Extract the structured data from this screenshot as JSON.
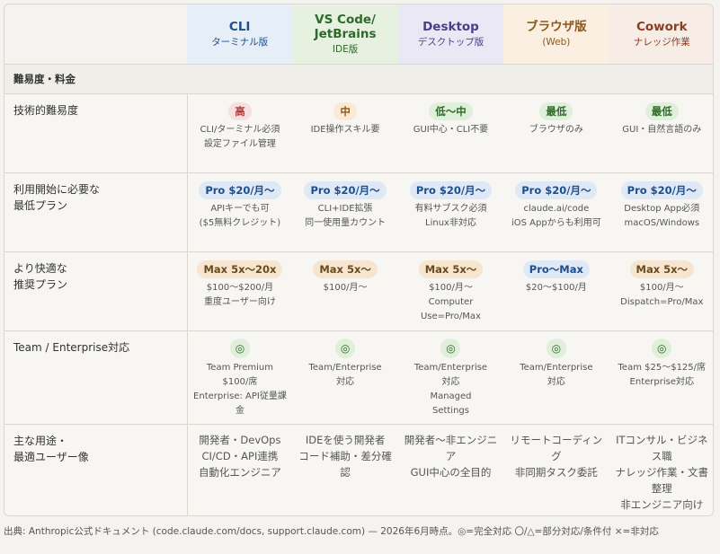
{
  "columns": [
    {
      "name": "CLI",
      "sub": "ターミナル版"
    },
    {
      "name": "VS Code/\nJetBrains",
      "sub": "IDE版"
    },
    {
      "name": "Desktop",
      "sub": "デスクトップ版"
    },
    {
      "name": "ブラウザ版",
      "sub": "(Web)"
    },
    {
      "name": "Cowork",
      "sub": "ナレッジ作業"
    }
  ],
  "section": "難易度・料金",
  "rows": [
    {
      "label": "技術的難易度",
      "cells": [
        {
          "pill": "高",
          "note": "CLI/ターミナル必須\n設定ファイル管理"
        },
        {
          "pill": "中",
          "note": "IDE操作スキル要"
        },
        {
          "pill": "低〜中",
          "note": "GUI中心・CLI不要"
        },
        {
          "pill": "最低",
          "note": "ブラウザのみ"
        },
        {
          "pill": "最低",
          "note": "GUI・自然言語のみ"
        }
      ]
    },
    {
      "label": "利用開始に必要な\n最低プラン",
      "cells": [
        {
          "pill": "Pro $20/月〜",
          "note": "APIキーでも可\n($5無料クレジット)"
        },
        {
          "pill": "Pro $20/月〜",
          "note": "CLI+IDE拡張\n同一使用量カウント"
        },
        {
          "pill": "Pro $20/月〜",
          "note": "有料サブスク必須\nLinux非対応"
        },
        {
          "pill": "Pro $20/月〜",
          "note": "claude.ai/code\niOS Appからも利用可"
        },
        {
          "pill": "Pro $20/月〜",
          "note": "Desktop App必須\nmacOS/Windows"
        }
      ]
    },
    {
      "label": "より快適な\n推奨プラン",
      "cells": [
        {
          "pill": "Max 5x〜20x",
          "note": "$100〜$200/月\n重度ユーザー向け"
        },
        {
          "pill": "Max 5x〜",
          "note": "$100/月〜"
        },
        {
          "pill": "Max 5x〜",
          "note": "$100/月〜\nComputer Use=Pro/Max"
        },
        {
          "pill": "Pro〜Max",
          "note": "$20〜$100/月"
        },
        {
          "pill": "Max 5x〜",
          "note": "$100/月〜\nDispatch=Pro/Max"
        }
      ]
    },
    {
      "label": "Team / Enterprise対応",
      "cells": [
        {
          "pill": "◎",
          "note": "Team Premium\n$100/席\nEnterprise: API従量課金"
        },
        {
          "pill": "◎",
          "note": "Team/Enterprise\n対応"
        },
        {
          "pill": "◎",
          "note": "Team/Enterprise\n対応\nManaged\nSettings"
        },
        {
          "pill": "◎",
          "note": "Team/Enterprise\n対応"
        },
        {
          "pill": "◎",
          "note": "Team $25〜$125/席\nEnterprise対応"
        }
      ]
    },
    {
      "label": "主な用途・\n最適ユーザー像",
      "cells": [
        {
          "note": "開発者・DevOps\nCI/CD・API連携\n自動化エンジニア"
        },
        {
          "note": "IDEを使う開発者\nコード補助・差分確認"
        },
        {
          "note": "開発者〜非エンジニア\nGUI中心の全目的"
        },
        {
          "note": "リモートコーディング\n非同期タスク委託"
        },
        {
          "note": "ITコンサル・ビジネス職\nナレッジ作業・文書整理\n非エンジニア向け"
        }
      ]
    }
  ],
  "footer": "出典: Anthropic公式ドキュメント (code.claude.com/docs, support.claude.com) — 2026年6月時点。◎=完全対応 〇/△=部分対応/条件付 ×=非対応"
}
